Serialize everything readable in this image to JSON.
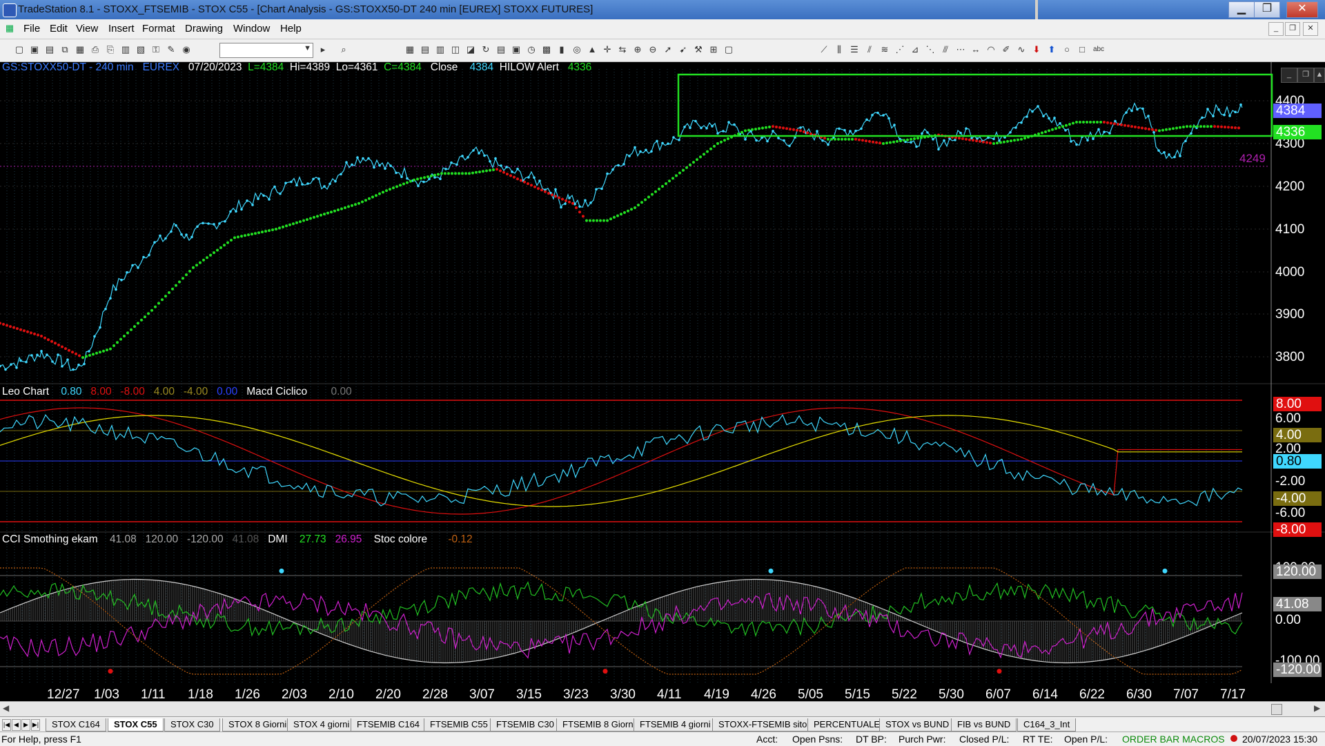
{
  "window": {
    "title": "TradeStation 8.1 - STOXX_FTSEMIB - STOX C55 - [Chart Analysis - GS:STOXX50-DT  240 min  [EUREX] STOXX FUTURES]",
    "min": "▁",
    "max": "❐",
    "close": "✕"
  },
  "menu": [
    "File",
    "Edit",
    "View",
    "Insert",
    "Format",
    "Drawing",
    "Window",
    "Help"
  ],
  "mdi": [
    "_",
    "❐",
    "✕"
  ],
  "toolbar": {
    "icons": [
      "new-doc-icon",
      "open-icon",
      "new-window-icon",
      "copy-icon",
      "open-folder-icon",
      "print-icon",
      "print-preview-icon",
      "layout-icon",
      "layout2-icon",
      "lock-icon",
      "paint-icon",
      "web-icon",
      "workspace-combo",
      "play-icon",
      "find-icon",
      "grid-icon",
      "grid2-icon",
      "table-icon",
      "chart-icon",
      "chart2-icon",
      "refresh-icon",
      "data-window-icon",
      "data2-icon",
      "clock-icon",
      "options-icon",
      "bar-chart-icon",
      "radar-icon",
      "alert-icon",
      "crosshair-icon",
      "swap-icon",
      "zoom-in-icon",
      "zoom-out-icon",
      "pointer-icon",
      "pointer-plus-icon",
      "tools-icon",
      "insert-icon",
      "window-icon",
      "trendline-icon",
      "vertical-lines-icon",
      "horizontal-lines-icon",
      "channel-icon",
      "fibonacci-icon",
      "speedline-icon",
      "gann-icon",
      "regression-icon",
      "andrews-icon",
      "fan-icon",
      "arrow-width-icon",
      "arc-icon",
      "pencil-icon",
      "curve-icon",
      "arrow-down-icon",
      "arrow-up-icon",
      "ellipse-icon",
      "rectangle-icon",
      "text-icon"
    ],
    "combo_value": ""
  },
  "chart_header": {
    "symbol": "GS:STOXX50-DT - 240 min",
    "exchange": "EUREX",
    "date": "07/20/2023",
    "last": "L=4384",
    "high": "Hi=4389",
    "low": "Lo=4361",
    "close_val": "C=4384",
    "close_label": "Close",
    "close_price": "4384",
    "alert_label": "HILOW Alert",
    "alert_value": "4336"
  },
  "leo_header": {
    "name": "Leo Chart",
    "v1": "0.80",
    "v2": "8.00",
    "v3": "-8.00",
    "v4": "4.00",
    "v5": "-4.00",
    "v6": "0.00",
    "macd": "Macd Ciclico",
    "macd_val": "0.00"
  },
  "cci_header": {
    "name": "CCI Smothing ekam",
    "v1": "41.08",
    "v2": "120.00",
    "v3": "-120.00",
    "v4": "41.08",
    "dmi": "DMI",
    "dmi1": "27.73",
    "dmi2": "26.95",
    "stoc": "Stoc colore",
    "stoc_val": "-0.12"
  },
  "price_axis": [
    "4400",
    "4300",
    "4200",
    "4100",
    "4000",
    "3900",
    "3800"
  ],
  "price_badges": {
    "last": "4384",
    "alert": "4336",
    "hline": "4249"
  },
  "leo_axis": [
    "8.00",
    "6.00",
    "4.00",
    "2.00",
    "0.80",
    "-2.00",
    "-4.00",
    "-6.00",
    "-8.00"
  ],
  "cci_axis": [
    "120.00",
    "100.00",
    "41.08",
    "0.00",
    "-100.00",
    "-120.00"
  ],
  "dates": [
    "12/27",
    "1/03",
    "1/11",
    "1/18",
    "1/26",
    "2/03",
    "2/10",
    "2/20",
    "2/28",
    "3/07",
    "3/15",
    "3/23",
    "3/30",
    "4/11",
    "4/19",
    "4/26",
    "5/05",
    "5/15",
    "5/22",
    "5/30",
    "6/07",
    "6/14",
    "6/22",
    "6/30",
    "7/07",
    "7/17"
  ],
  "tabs": [
    "STOX C164",
    "STOX C55",
    "STOX  C30",
    "STOX  8 Giorni",
    "STOX 4 giorni",
    "FTSEMIB C164",
    "FTSEMIB C55",
    "FTSEMIB C30",
    "FTSEMIB  8 Giorni",
    "FTSEMIB  4 giorni",
    "STOXX-FTSEMIB sito",
    "PERCENTUALE",
    "STOX vs BUND",
    "FIB vs BUND",
    "C164_3_Int"
  ],
  "active_tab": "STOX C55",
  "status": {
    "help": "For Help, press F1",
    "acct": "Acct:",
    "open_psns": "Open Psns:",
    "dt_bp": "DT BP:",
    "purch_pwr": "Purch Pwr:",
    "closed_pl": "Closed P/L:",
    "rt_te": "RT TE:",
    "open_pl": "Open P/L:",
    "macros": "ORDER BAR  MACROS",
    "datetime": "20/07/2023 15:30"
  },
  "colors": {
    "price": "#3fd8ff",
    "ma_up": "#22e022",
    "ma_down": "#e01010",
    "macd_yellow": "#e8e000",
    "macd_red": "#e01010",
    "cci_white": "#cfcfcf",
    "dmi_green": "#22c022",
    "stoc_magenta": "#d020d0",
    "stoc_orange": "#c06010",
    "box": "#22e022",
    "header_cyan": "#3a7bff"
  }
}
